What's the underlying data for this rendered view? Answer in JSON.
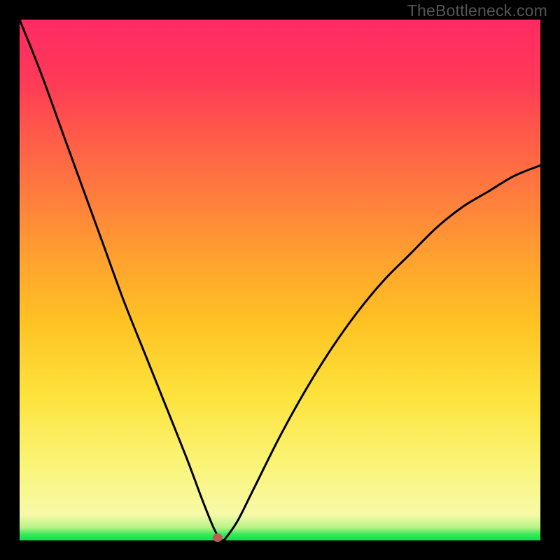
{
  "attribution": "TheBottleneck.com",
  "chart_data": {
    "type": "line",
    "title": "",
    "xlabel": "",
    "ylabel": "",
    "xlim": [
      0,
      100
    ],
    "ylim": [
      0,
      100
    ],
    "legend": {
      "mapping": "background color encodes y-value",
      "stops": [
        {
          "y": 0,
          "color": "#00e54e"
        },
        {
          "y": 5,
          "color": "#f7f9a8"
        },
        {
          "y": 28,
          "color": "#fde23b"
        },
        {
          "y": 55,
          "color": "#ff9f30"
        },
        {
          "y": 78,
          "color": "#ff5a49"
        },
        {
          "y": 100,
          "color": "#ff2a63"
        }
      ]
    },
    "series": [
      {
        "name": "bottleneck-curve",
        "x": [
          0,
          4,
          8,
          12,
          16,
          20,
          24,
          28,
          32,
          35,
          37,
          38,
          39,
          40,
          42,
          45,
          50,
          55,
          60,
          65,
          70,
          75,
          80,
          85,
          90,
          95,
          100
        ],
        "y": [
          100,
          90,
          79,
          68,
          57,
          46,
          36,
          26,
          16,
          8,
          3,
          1,
          0,
          1,
          4,
          10,
          20,
          29,
          37,
          44,
          50,
          55,
          60,
          64,
          67,
          70,
          72
        ]
      }
    ],
    "minimum_marker": {
      "x": 38,
      "y": 0
    }
  }
}
